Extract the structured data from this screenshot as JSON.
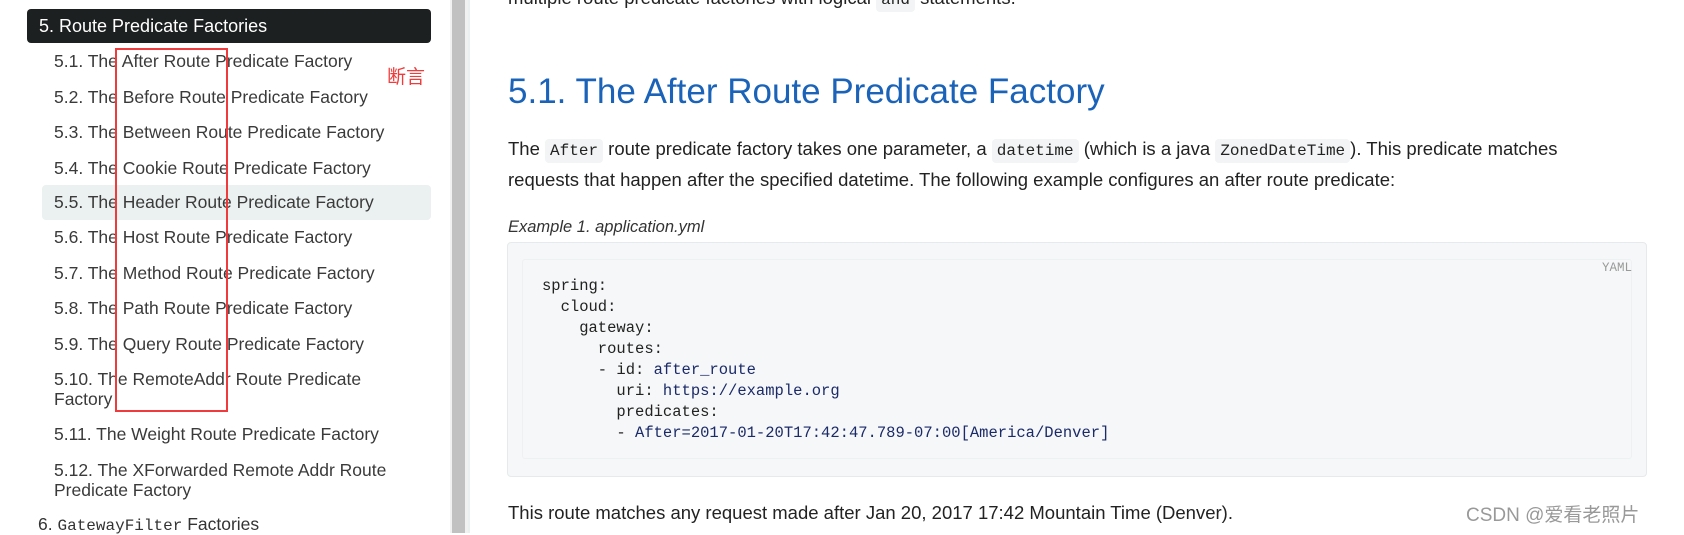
{
  "sidebar": {
    "section": {
      "label": "5. Route Predicate Factories"
    },
    "items": [
      {
        "label": "5.1. The After Route Predicate Factory",
        "active": false
      },
      {
        "label": "5.2. The Before Route Predicate Factory",
        "active": false
      },
      {
        "label": "5.3. The Between Route Predicate Factory",
        "active": false
      },
      {
        "label": "5.4. The Cookie Route Predicate Factory",
        "active": false
      },
      {
        "label": "5.5. The Header Route Predicate Factory",
        "active": true
      },
      {
        "label": "5.6. The Host Route Predicate Factory",
        "active": false
      },
      {
        "label": "5.7. The Method Route Predicate Factory",
        "active": false
      },
      {
        "label": "5.8. The Path Route Predicate Factory",
        "active": false
      },
      {
        "label": "5.9. The Query Route Predicate Factory",
        "active": false
      },
      {
        "label_line1": "5.10. The RemoteAddr Route Predicate",
        "label_line2": "Factory",
        "active": false
      },
      {
        "label": "5.11. The Weight Route Predicate Factory",
        "active": false
      },
      {
        "label_line1": "5.12. The XForwarded Remote Addr Route",
        "label_line2": "Predicate Factory",
        "active": false
      }
    ],
    "next_section": {
      "number": "6.",
      "code": "GatewayFilter",
      "rest": "Factories"
    }
  },
  "annotation": {
    "label": "断言",
    "color": "#ef3b3b"
  },
  "content": {
    "top_line": {
      "before": "multiple route predicate factories with logical ",
      "code": "and",
      "after": " statements."
    },
    "heading": "5.1. The After Route Predicate Factory",
    "para": {
      "t1": "The ",
      "c1": "After",
      "t2": " route predicate factory takes one parameter, a ",
      "c2": "datetime",
      "t3": " (which is a java ",
      "c3": "ZonedDateTime",
      "t4": "). This predicate matches",
      "line2": "requests that happen after the specified datetime. The following example configures an after route predicate:"
    },
    "example_caption": "Example 1. application.yml",
    "code_block": {
      "language": "YAML",
      "lines": [
        {
          "indent": "",
          "key": "spring:",
          "val": ""
        },
        {
          "indent": "  ",
          "key": "cloud:",
          "val": ""
        },
        {
          "indent": "    ",
          "key": "gateway:",
          "val": ""
        },
        {
          "indent": "      ",
          "key": "routes:",
          "val": ""
        },
        {
          "indent": "      ",
          "key": "- id: ",
          "val": "after_route"
        },
        {
          "indent": "        ",
          "key": "uri: ",
          "val": "https://example.org"
        },
        {
          "indent": "        ",
          "key": "predicates:",
          "val": ""
        },
        {
          "indent": "        ",
          "key": "- ",
          "val": "After=2017-01-20T17:42:47.789-07:00[America/Denver]"
        }
      ]
    },
    "after_text": "This route matches any request made after Jan 20, 2017 17:42 Mountain Time (Denver)."
  },
  "watermark": "CSDN @爱看老照片",
  "colors": {
    "heading": "#1a63b8",
    "active_section_bg": "#1d2021",
    "active_item_bg": "#ebf0f0",
    "annotation": "#ef3b3b"
  }
}
